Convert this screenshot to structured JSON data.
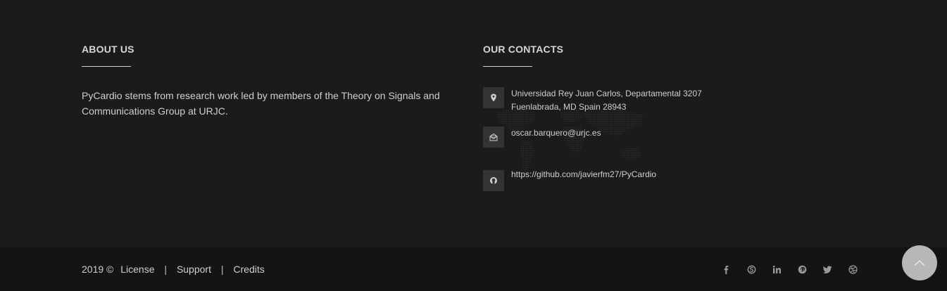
{
  "about": {
    "heading": "ABOUT US",
    "text": "PyCardio stems from research work led by members of the Theory on Signals and Communications Group at URJC."
  },
  "contacts": {
    "heading": "OUR CONTACTS",
    "address_line1": "Universidad Rey Juan Carlos, Departamental 3207",
    "address_line2": "Fuenlabrada, MD Spain 28943",
    "email": "oscar.barquero@urjc.es",
    "github": "https://github.com/javierfm27/PyCardio",
    "icons": [
      "map-pin-icon",
      "envelope-icon",
      "github-icon"
    ]
  },
  "footer": {
    "copyright": "2019 ©",
    "links": {
      "license": "License",
      "support": "Support",
      "credits": "Credits"
    },
    "separator": "|",
    "social_icons": [
      "facebook-icon",
      "skype-icon",
      "linkedin-icon",
      "pinterest-icon",
      "twitter-icon",
      "dribbble-icon"
    ]
  },
  "colors": {
    "background": "#1b1b1b",
    "bottom_bar": "#141414",
    "icon_box": "#333333",
    "scroll_button": "#b7b7b7"
  }
}
